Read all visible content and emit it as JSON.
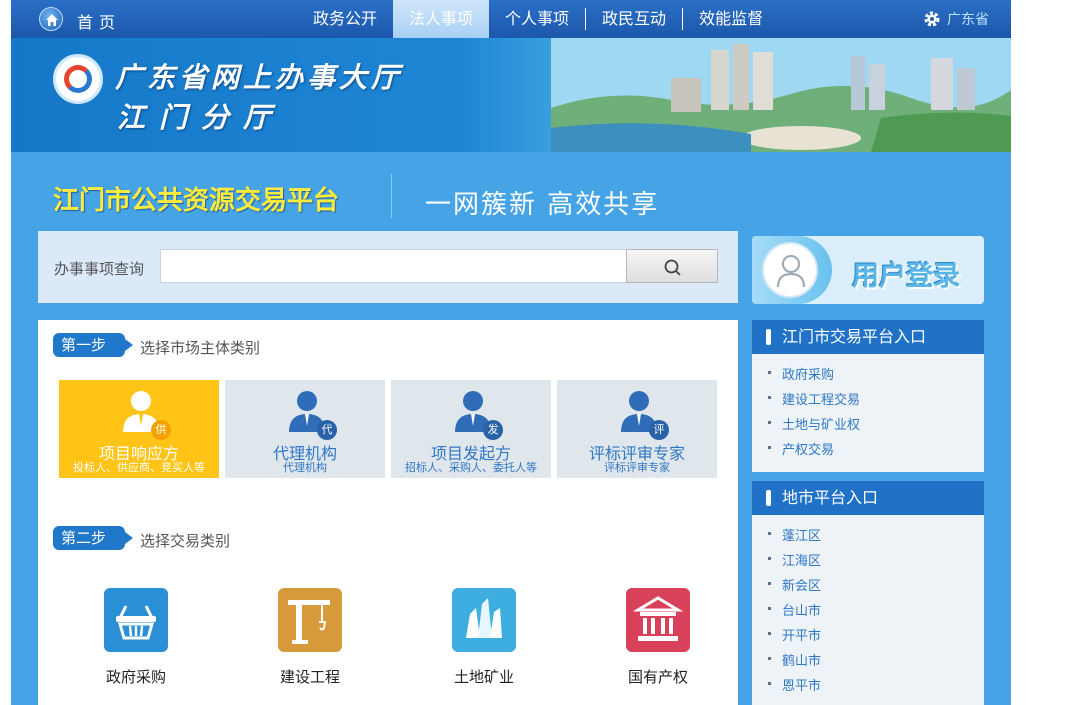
{
  "topbar": {
    "home_label": "首页",
    "nav": [
      "政务公开",
      "法人事项",
      "个人事项",
      "政民互动",
      "效能监督"
    ],
    "active_nav": "法人事项",
    "region": "广东省"
  },
  "banner": {
    "title": "广东省网上办事大厅",
    "subtitle": "江门分厅"
  },
  "platform": {
    "title": "江门市公共资源交易平台",
    "slogan": "一网簇新 高效共享"
  },
  "search": {
    "label": "办事事项查询",
    "placeholder": ""
  },
  "login": {
    "label": "用户登录"
  },
  "step1": {
    "badge": "第一步",
    "desc": "选择市场主体类别",
    "cards": [
      {
        "title": "项目响应方",
        "sub": "投标人、供应商、竞买人等",
        "badge": "供",
        "active": true
      },
      {
        "title": "代理机构",
        "sub": "代理机构",
        "badge": "代",
        "active": false
      },
      {
        "title": "项目发起方",
        "sub": "招标人、采购人、委托人等",
        "badge": "发",
        "active": false
      },
      {
        "title": "评标评审专家",
        "sub": "评标评审专家",
        "badge": "评",
        "active": false
      }
    ]
  },
  "step2": {
    "badge": "第二步",
    "desc": "选择交易类别",
    "categories": [
      {
        "label": "政府采购",
        "icon": "basket-icon",
        "color": "#2b8fd6"
      },
      {
        "label": "建设工程",
        "icon": "crane-icon",
        "color": "#d79a3a"
      },
      {
        "label": "土地矿业",
        "icon": "crystal-icon",
        "color": "#3eaee0"
      },
      {
        "label": "国有产权",
        "icon": "bank-icon",
        "color": "#d9405a"
      }
    ]
  },
  "panel1": {
    "title": "江门市交易平台入口",
    "items": [
      "政府采购",
      "建设工程交易",
      "土地与矿业权",
      "产权交易"
    ]
  },
  "panel2": {
    "title": "地市平台入口",
    "items": [
      "蓬江区",
      "江海区",
      "新会区",
      "台山市",
      "开平市",
      "鹤山市",
      "恩平市"
    ]
  }
}
